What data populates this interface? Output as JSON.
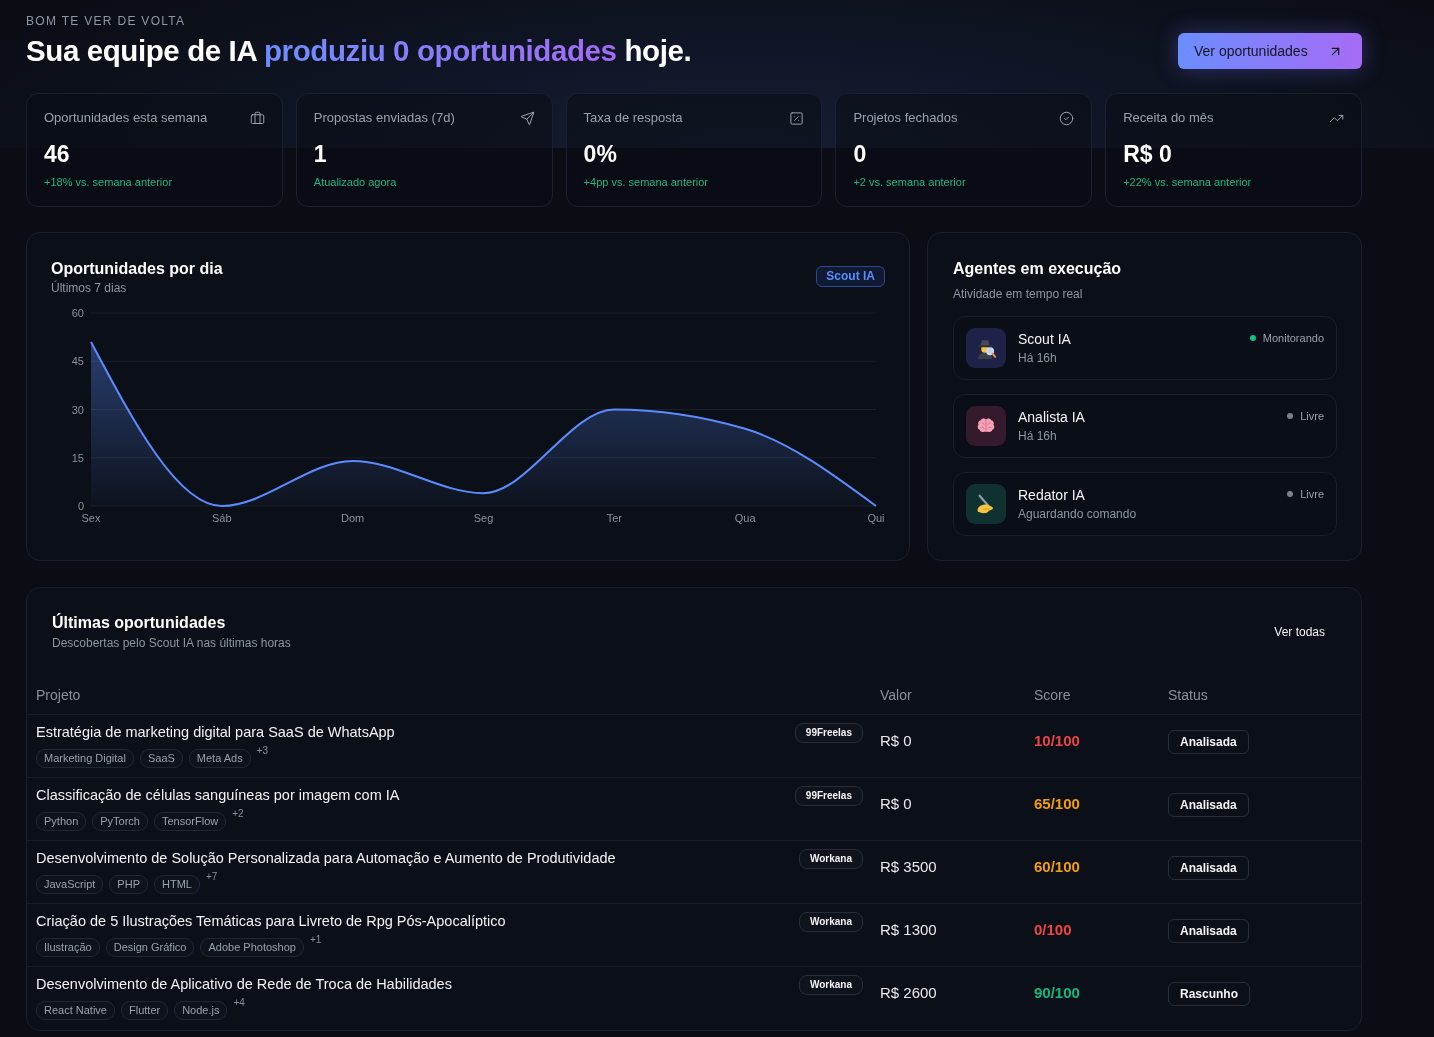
{
  "header": {
    "eyebrow": "BOM TE VER DE VOLTA",
    "title": {
      "lead": "Sua equipe de IA ",
      "highlight": "produziu 0 oportunidades",
      "tail": " hoje."
    },
    "action_button": "Ver oportunidades"
  },
  "stats": [
    {
      "label": "Oportunidades esta semana",
      "value": "46",
      "delta": "+18% vs. semana anterior"
    },
    {
      "label": "Propostas enviadas (7d)",
      "value": "1",
      "delta": "Atualizado agora"
    },
    {
      "label": "Taxa de resposta",
      "value": "0%",
      "delta": "+4pp vs. semana anterior"
    },
    {
      "label": "Projetos fechados",
      "value": "0",
      "delta": "+2 vs. semana anterior"
    },
    {
      "label": "Receita do mês",
      "value": "R$ 0",
      "delta": "+22% vs. semana anterior"
    }
  ],
  "chart_card": {
    "subtitle": "Últimos 7 dias",
    "badge": "Scout IA",
    "chart_data": {
      "type": "area",
      "title": "Oportunidades por dia",
      "categories": [
        "Sex",
        "Sáb",
        "Dom",
        "Seg",
        "Ter",
        "Qua",
        "Qui"
      ],
      "series": [
        {
          "color": "#5b8cff",
          "values": [
            51,
            0,
            14,
            4,
            30,
            24,
            0
          ]
        }
      ],
      "ylim": [
        0,
        60
      ],
      "yticks": [
        0,
        15,
        30,
        45,
        60
      ],
      "grid": true
    }
  },
  "agents_panel": {
    "title": "Agentes em execução",
    "subtitle": "Atividade em tempo real",
    "agents": [
      {
        "name": "Scout IA",
        "detail": "Há 16h",
        "status": "Monitorando",
        "active": true,
        "color": "#1f2248"
      },
      {
        "name": "Analista IA",
        "detail": "Há 16h",
        "status": "Livre",
        "active": false,
        "color": "#341a2b"
      },
      {
        "name": "Redator IA",
        "detail": "Aguardando comando",
        "status": "Livre",
        "active": false,
        "color": "#0f3230"
      }
    ]
  },
  "opportunities": {
    "title": "Últimas oportunidades",
    "subtitle": "Descobertas pelo Scout IA nas últimas horas",
    "link": "Ver todas",
    "columns": [
      "Projeto",
      "Valor",
      "Score",
      "Status"
    ],
    "rows": [
      {
        "title": "Estratégia de marketing digital para SaaS de WhatsApp",
        "tags": {
          "items": [
            "Marketing Digital",
            "SaaS",
            "Meta Ads"
          ],
          "more": "+3"
        },
        "platform": "99Freelas",
        "value": "R$ 0",
        "score": {
          "text": "10/100",
          "color": "#ef4444"
        },
        "status": "Analisada"
      },
      {
        "title": "Classificação de células sanguíneas por imagem com IA",
        "tags": {
          "items": [
            "Python",
            "PyTorch",
            "TensorFlow"
          ],
          "more": "+2"
        },
        "platform": "99Freelas",
        "value": "R$ 0",
        "score": {
          "text": "65/100",
          "color": "#f59e0b"
        },
        "status": "Analisada"
      },
      {
        "title": "Desenvolvimento de Solução Personalizada para Automação e Aumento de Produtividade",
        "tags": {
          "items": [
            "JavaScript",
            "PHP",
            "HTML"
          ],
          "more": "+7"
        },
        "platform": "Workana",
        "value": "R$ 3500",
        "score": {
          "text": "60/100",
          "color": "#f59e0b"
        },
        "status": "Analisada"
      },
      {
        "title": "Criação de 5 Ilustrações Temáticas para Livreto de Rpg Pós-Apocalíptico",
        "tags": {
          "items": [
            "Ilustração",
            "Design Gráfico",
            "Adobe Photoshop"
          ],
          "more": "+1"
        },
        "platform": "Workana",
        "value": "R$ 1300",
        "score": {
          "text": "0/100",
          "color": "#ef4444"
        },
        "status": "Analisada"
      },
      {
        "title": "Desenvolvimento de Aplicativo de Rede de Troca de Habilidades",
        "tags": {
          "items": [
            "React Native",
            "Flutter",
            "Node.js"
          ],
          "more": "+4"
        },
        "platform": "Workana",
        "value": "R$ 2600",
        "score": {
          "text": "90/100",
          "color": "#10b981"
        },
        "status": "Rascunho"
      }
    ]
  }
}
